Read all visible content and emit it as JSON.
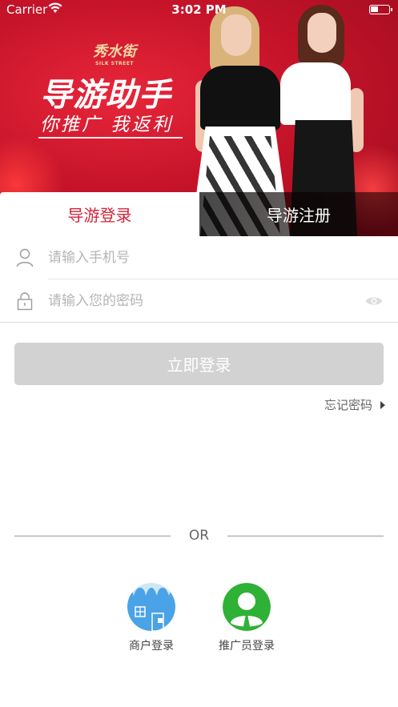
{
  "status_bar": {
    "carrier": "Carrier",
    "time": "3:02 PM"
  },
  "banner": {
    "brand_cn": "秀水街",
    "brand_en": "SILK STREET",
    "headline": "导游助手",
    "subline": "你推广 我返利"
  },
  "tabs": {
    "login": "导游登录",
    "register": "导游注册"
  },
  "form": {
    "phone_placeholder": "请输入手机号",
    "password_placeholder": "请输入您的密码",
    "login_button": "立即登录",
    "forgot_password": "忘记密码"
  },
  "divider": {
    "text": "OR"
  },
  "alt_logins": {
    "merchant": "商户登录",
    "promoter": "推广员登录"
  },
  "colors": {
    "accent_red": "#d0243a",
    "banner_red": "#c7142a",
    "button_disabled": "#d2d2d2",
    "merchant_blue": "#4aa3e6",
    "promoter_green": "#2fb135"
  }
}
